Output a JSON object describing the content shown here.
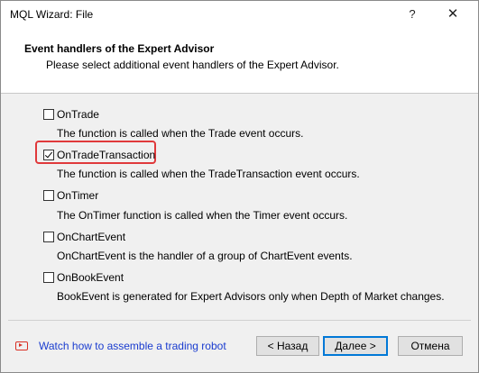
{
  "window": {
    "title": "MQL Wizard: File",
    "help_symbol": "?",
    "close_symbol": "✕"
  },
  "header": {
    "title": "Event handlers of the Expert Advisor",
    "subtitle": "Please select additional event handlers of the Expert Advisor."
  },
  "handlers": [
    {
      "label": "OnTrade",
      "checked": false,
      "description": "The function is called when the Trade event occurs."
    },
    {
      "label": "OnTradeTransaction",
      "checked": true,
      "description": "The function is called when the TradeTransaction event occurs."
    },
    {
      "label": "OnTimer",
      "checked": false,
      "description": "The OnTimer function is called when the Timer event occurs."
    },
    {
      "label": "OnChartEvent",
      "checked": false,
      "description": "OnChartEvent is the handler of a group of ChartEvent events."
    },
    {
      "label": "OnBookEvent",
      "checked": false,
      "description": "BookEvent is generated for Expert Advisors only when Depth of Market changes."
    }
  ],
  "footer": {
    "video_link": "Watch how to assemble a trading robot",
    "video_icon": "youtube-play-icon",
    "back_label": "< Назад",
    "next_label": "Далее >",
    "cancel_label": "Отмена"
  },
  "colors": {
    "highlight": "#e0393b",
    "link": "#1a3ccf",
    "primary_border": "#0078d7"
  }
}
